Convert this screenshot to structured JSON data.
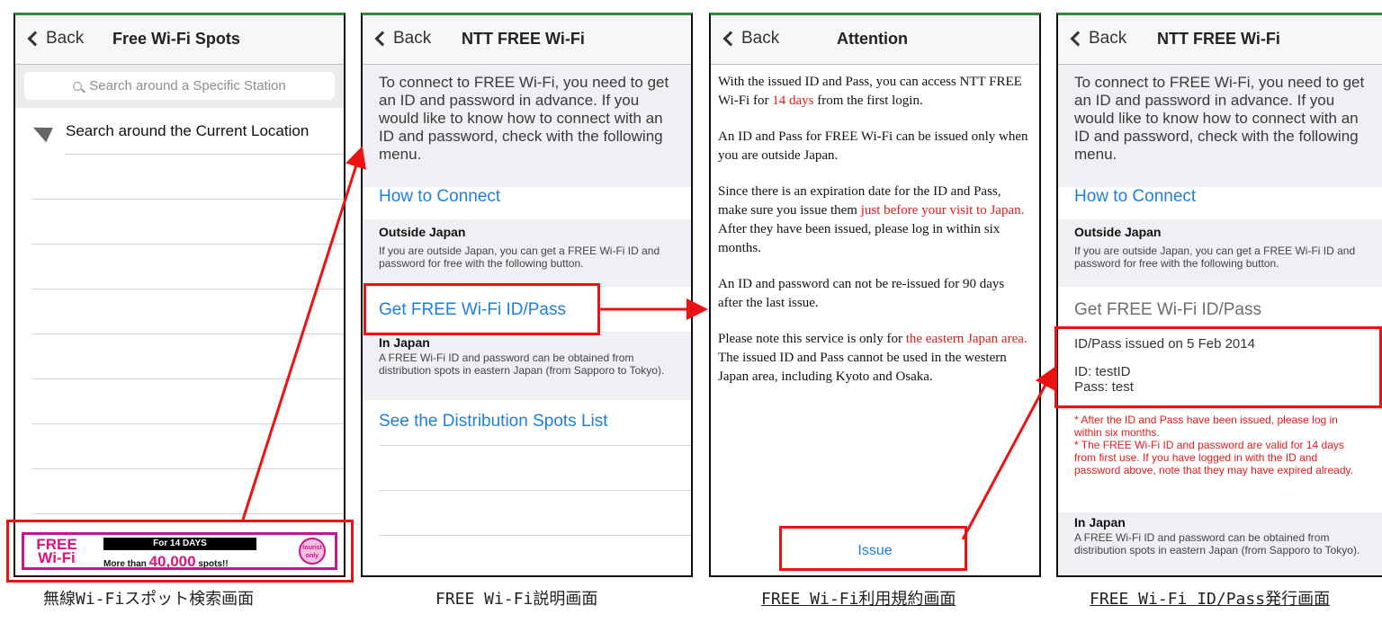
{
  "common": {
    "back_label": "Back"
  },
  "screen1": {
    "title": "Free Wi-Fi Spots",
    "search_placeholder": "Search around a Specific Station",
    "location_label": "Search around the Current Location",
    "banner": {
      "free_line1": "FREE",
      "free_line2": "Wi-Fi",
      "days": "For 14 DAYS",
      "spots_prefix": "More than ",
      "spots_count": "40,000",
      "spots_suffix": " spots!!",
      "badge_line1": "tourist",
      "badge_line2": "only"
    },
    "caption": "無線Wi-Fiスポット検索画面"
  },
  "screen2": {
    "title": "NTT FREE Wi-Fi",
    "intro": "To connect to FREE Wi-Fi, you need to get an ID and password in advance. If you would like to know how to connect with an ID and password, check with the following menu.",
    "how_to_connect": "How to Connect",
    "outside_head": "Outside Japan",
    "outside_text": "If you are outside Japan, you can get a FREE Wi-Fi ID and password for free with the following button.",
    "get_link": "Get FREE Wi-Fi ID/Pass",
    "injapan_head": "In Japan",
    "injapan_text": "A FREE Wi-Fi ID and password can be obtained from distribution spots in eastern Japan (from Sapporo to Tokyo).",
    "distribution_link": "See the Distribution Spots List",
    "caption": "FREE Wi-Fi説明画面"
  },
  "screen3": {
    "title": "Attention",
    "p1_a": "With the issued ID and Pass, you can access NTT FREE Wi-Fi for ",
    "p1_red": "14 days",
    "p1_b": " from the first login.",
    "p2": "An ID and Pass for FREE Wi-Fi can be issued only when you are outside Japan.",
    "p3_a": "Since there is an expiration date for the ID and Pass, make sure you issue them ",
    "p3_red": "just before your visit to Japan.",
    "p3_b": " After they have been issued, please log in within six months.",
    "p4": "An ID and password can not be re-issued for 90 days after the last issue.",
    "p5_a": "Please note this service is only for ",
    "p5_red": "the eastern Japan area.",
    "p5_b": " The issued ID and Pass cannot be used in the western Japan area, including Kyoto and Osaka.",
    "issue_button": "Issue",
    "caption": "FREE Wi-Fi利用規約画面"
  },
  "screen4": {
    "title": "NTT FREE Wi-Fi",
    "intro": "To connect to FREE Wi-Fi, you need to get an ID and password in advance. If you would like to know how to connect with an ID and password, check with the following menu.",
    "how_to_connect": "How to Connect",
    "outside_head": "Outside Japan",
    "outside_text": "If you are outside Japan, you can get a FREE Wi-Fi ID and password for free with the following button.",
    "get_link": "Get FREE Wi-Fi ID/Pass",
    "issued_on": "ID/Pass issued on 5 Feb 2014",
    "id_line": "ID: testID",
    "pass_line": "Pass: test",
    "warn1": "* After the ID and Pass have been issued, please log in within six months.",
    "warn2": "* The FREE Wi-Fi ID and password are valid for 14 days from first use. If you have logged in with the ID and password above, note that they may have expired already.",
    "injapan_head": "In Japan",
    "injapan_text": "A FREE Wi-Fi ID and password can be obtained from distribution spots in eastern Japan (from Sapporo to Tokyo).",
    "caption": "FREE Wi-Fi ID/Pass発行画面"
  },
  "colors": {
    "annotation": "#ee1111",
    "link": "#1f7fd8",
    "brand_pink": "#d6157f",
    "status_green": "#2f8a3a"
  }
}
